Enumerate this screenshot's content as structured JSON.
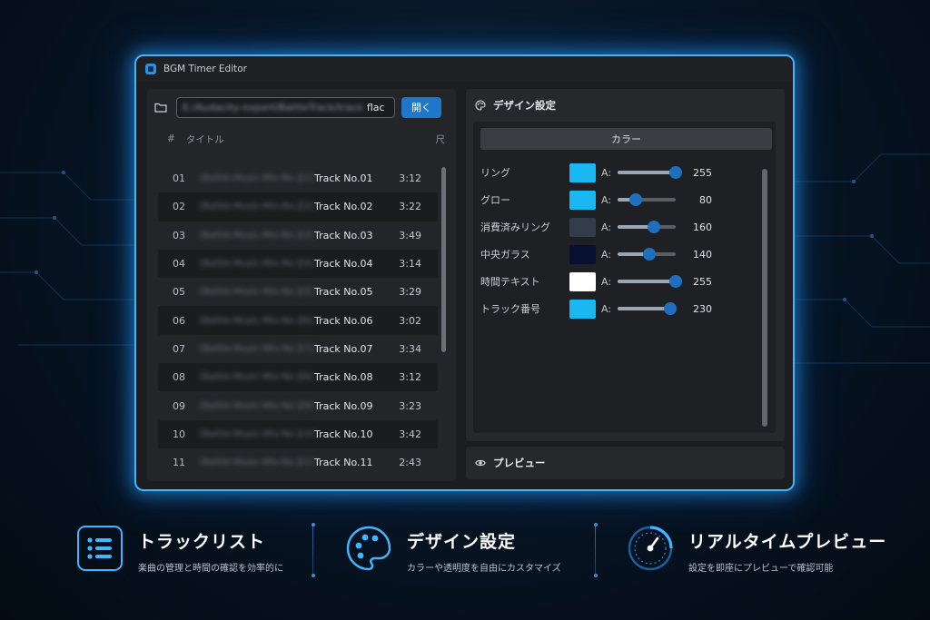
{
  "window": {
    "title": "BGM Timer Editor"
  },
  "file": {
    "path_hidden": "E:/Audacity-export/BattleTrack/track",
    "path_suffix": "flac",
    "open_label": "開く"
  },
  "list": {
    "headers": {
      "num": "#",
      "title": "タイトル",
      "length": "尺"
    },
    "rows": [
      {
        "num": "01",
        "path": "[Battle-Music-Mix-No.][1]",
        "name": "Track No.01",
        "dur": "3:12"
      },
      {
        "num": "02",
        "path": "[Battle-Music-Mix-No.][2]",
        "name": "Track No.02",
        "dur": "3:22"
      },
      {
        "num": "03",
        "path": "[Battle-Music-Mix-No.][3]",
        "name": "Track No.03",
        "dur": "3:49"
      },
      {
        "num": "04",
        "path": "[Battle-Music-Mix-No.][4]",
        "name": "Track No.04",
        "dur": "3:14"
      },
      {
        "num": "05",
        "path": "[Battle-Music-Mix-No.][5]",
        "name": "Track No.05",
        "dur": "3:29"
      },
      {
        "num": "06",
        "path": "[Battle-Music-Mix-No.][6]",
        "name": "Track No.06",
        "dur": "3:02"
      },
      {
        "num": "07",
        "path": "[Battle-Music-Mix-No.][7]",
        "name": "Track No.07",
        "dur": "3:34"
      },
      {
        "num": "08",
        "path": "[Battle-Music-Mix-No.][8]",
        "name": "Track No.08",
        "dur": "3:12"
      },
      {
        "num": "09",
        "path": "[Battle-Music-Mix-No.][9]",
        "name": "Track No.09",
        "dur": "3:23"
      },
      {
        "num": "10",
        "path": "[Battle-Music-Mix-No.][10]",
        "name": "Track No.10",
        "dur": "3:42"
      },
      {
        "num": "11",
        "path": "[Battle-Music-Mix-No.][11]",
        "name": "Track No.11",
        "dur": "2:43"
      }
    ]
  },
  "design": {
    "title": "デザイン設定",
    "tab_label": "カラー",
    "alpha_label": "A:",
    "alpha_max": 255,
    "rows": [
      {
        "label": "リング",
        "color": "#1ab8f2",
        "alpha": "255"
      },
      {
        "label": "グロー",
        "color": "#1ab8f2",
        "alpha": "80"
      },
      {
        "label": "消費済みリング",
        "color": "#333c4a",
        "alpha": "160"
      },
      {
        "label": "中央ガラス",
        "color": "#07102e",
        "alpha": "140"
      },
      {
        "label": "時間テキスト",
        "color": "#ffffff",
        "alpha": "255"
      },
      {
        "label": "トラック番号",
        "color": "#1ab8f2",
        "alpha": "230"
      }
    ]
  },
  "preview": {
    "title": "プレビュー"
  },
  "features": [
    {
      "title": "トラックリスト",
      "desc": "楽曲の管理と時間の確認を効率的に",
      "icon": "list-icon"
    },
    {
      "title": "デザイン設定",
      "desc": "カラーや透明度を自由にカスタマイズ",
      "icon": "palette-icon"
    },
    {
      "title": "リアルタイムプレビュー",
      "desc": "設定を即座にプレビューで確認可能",
      "icon": "timer-gauge-icon"
    }
  ],
  "colors": {
    "accent": "#3fb6ff",
    "button": "#1e77c8",
    "background": "#071525"
  }
}
